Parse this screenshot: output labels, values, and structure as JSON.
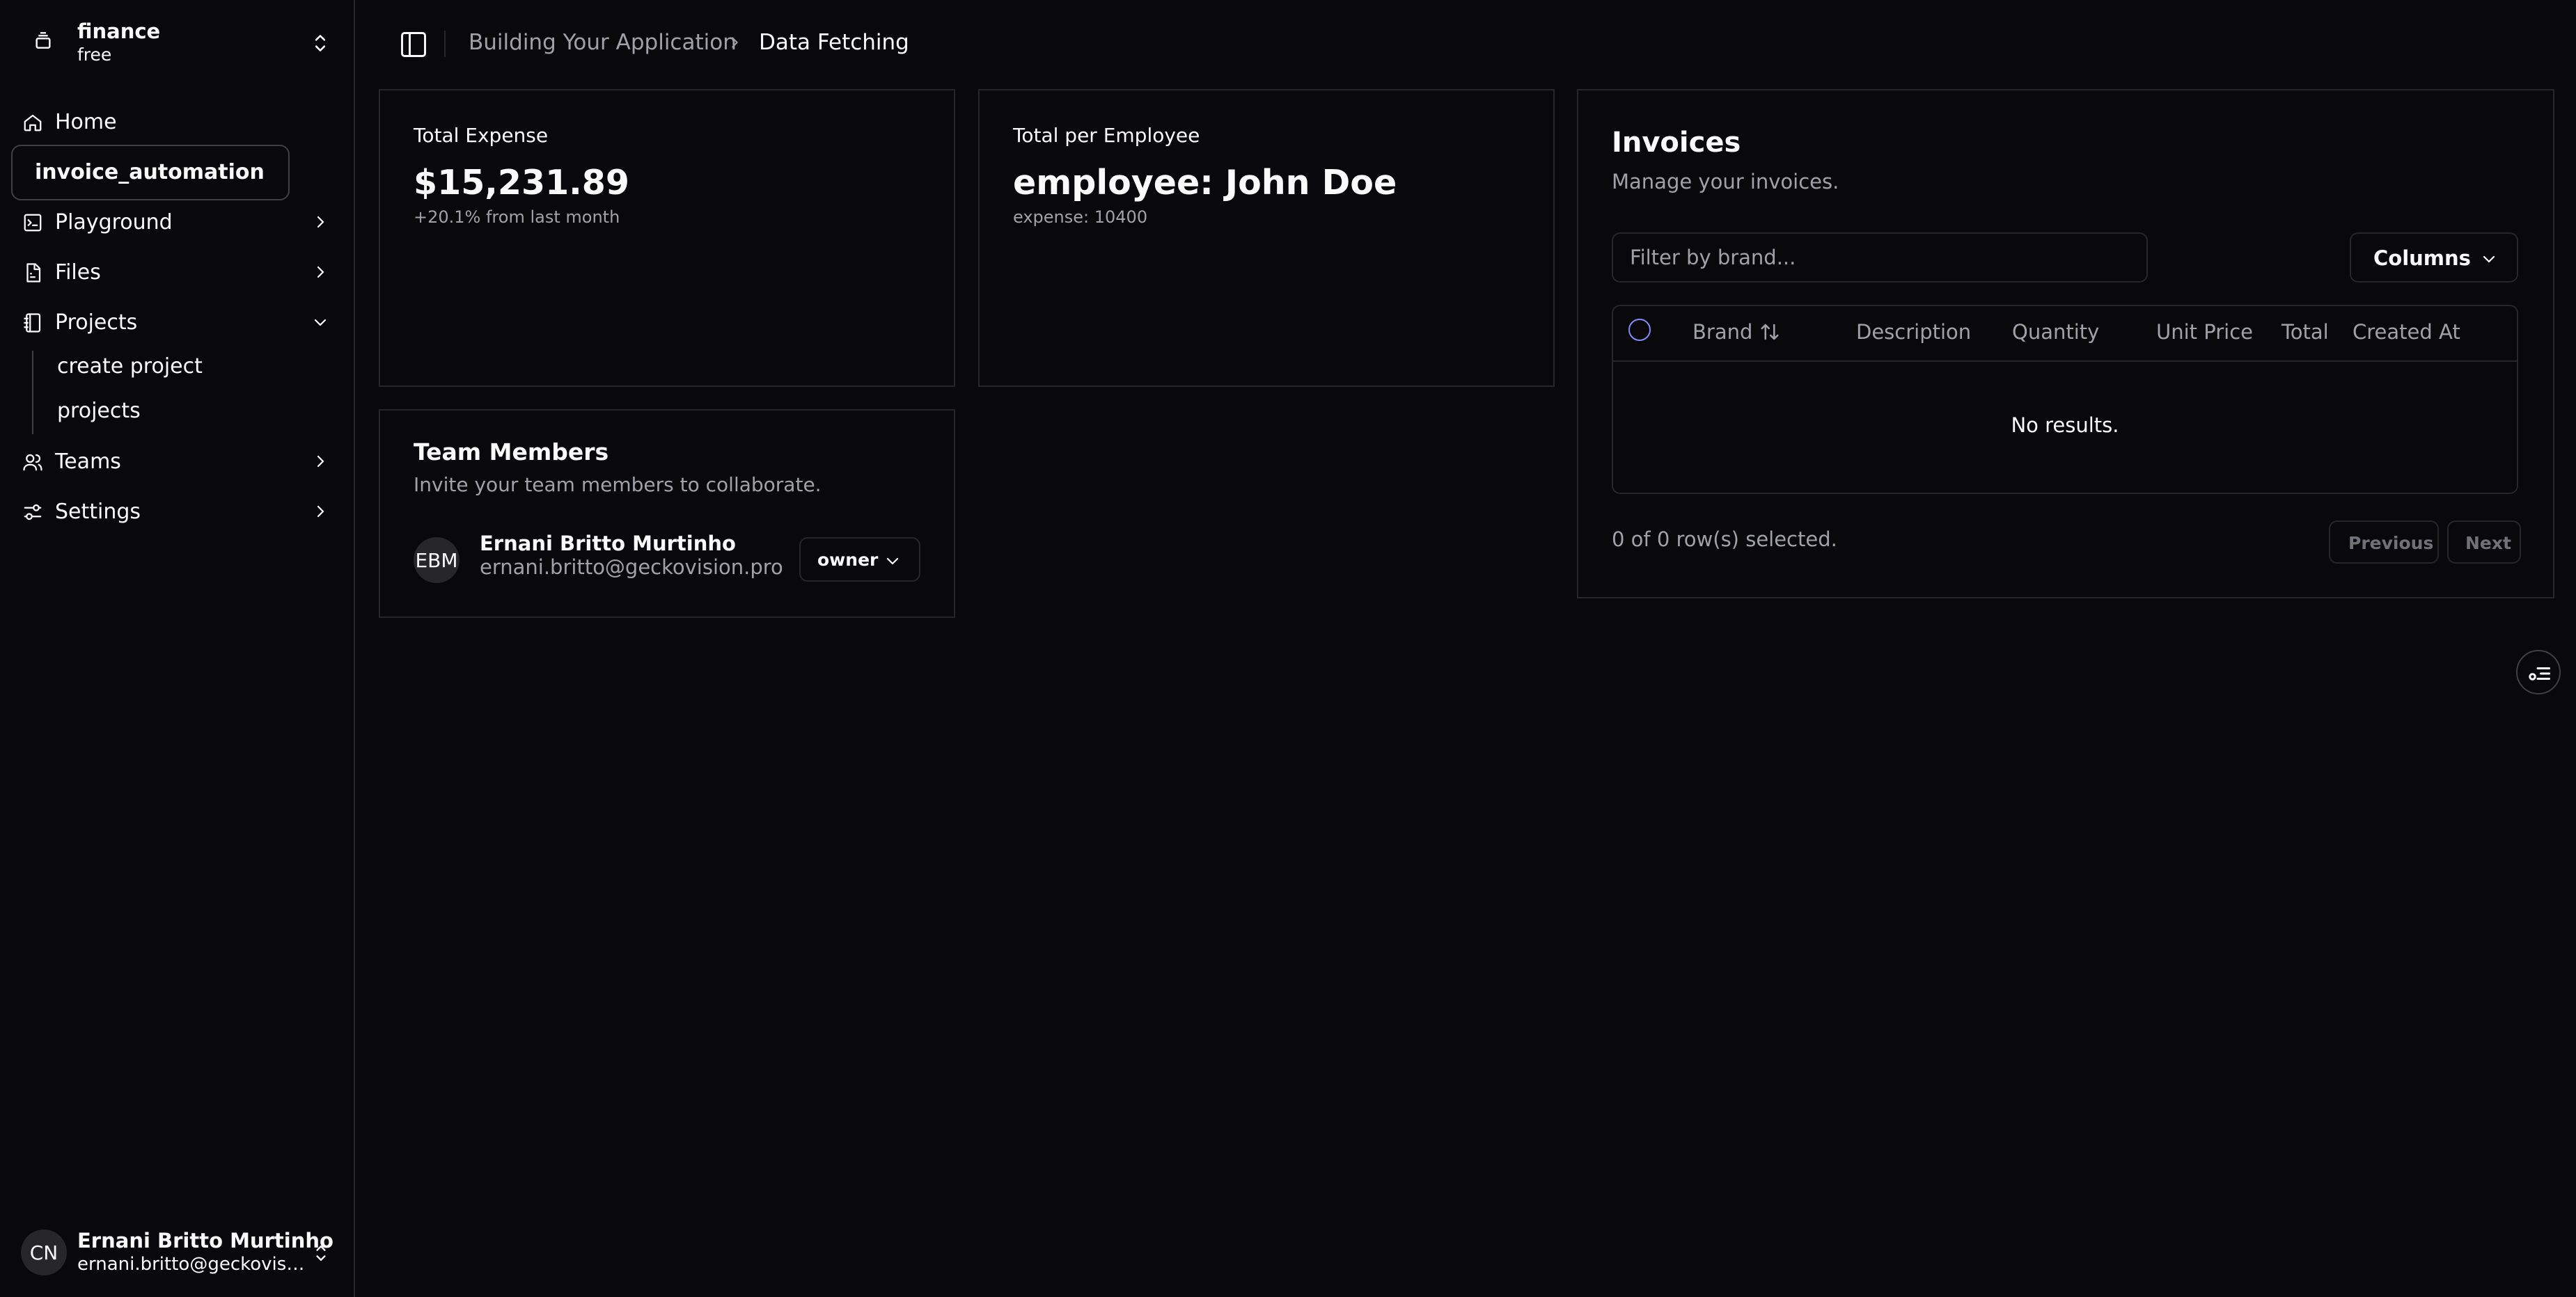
{
  "sidebar": {
    "org": {
      "name": "finance",
      "plan": "free"
    },
    "items": [
      {
        "label": "Home"
      },
      {
        "label": "invoice_automation"
      },
      {
        "label": "Playground"
      },
      {
        "label": "Files"
      },
      {
        "label": "Projects"
      },
      {
        "label": "Teams"
      },
      {
        "label": "Settings"
      }
    ],
    "projects_sub": [
      {
        "label": "create project"
      },
      {
        "label": "projects"
      }
    ],
    "user": {
      "initials": "CN",
      "name": "Ernani Britto Murtinho",
      "email": "ernani.britto@geckovision.pro"
    }
  },
  "header": {
    "breadcrumb": [
      "Building Your Application",
      "Data Fetching"
    ]
  },
  "total_expense": {
    "title": "Total Expense",
    "value": "$15,231.89",
    "delta": "+20.1% from last month"
  },
  "total_per_employee": {
    "title": "Total per Employee",
    "value": "employee: John Doe",
    "sub": "expense: 10400"
  },
  "team": {
    "title": "Team Members",
    "description": "Invite your team members to collaborate.",
    "members": [
      {
        "initials": "EBM",
        "name": "Ernani Britto Murtinho",
        "email": "ernani.britto@geckovision.pro",
        "role": "owner"
      }
    ]
  },
  "invoices": {
    "title": "Invoices",
    "description": "Manage your invoices.",
    "filter_placeholder": "Filter by brand...",
    "columns_label": "Columns",
    "headers": [
      "Brand",
      "Description",
      "Quantity",
      "Unit Price",
      "Total",
      "Created At"
    ],
    "empty_text": "No results.",
    "selection_text": "0 of 0 row(s) selected.",
    "previous_label": "Previous",
    "next_label": "Next"
  },
  "colors": {
    "background": "#09090b",
    "border": "#27272a",
    "muted_text": "#a1a1aa",
    "checkbox_accent": "#818cf8"
  }
}
